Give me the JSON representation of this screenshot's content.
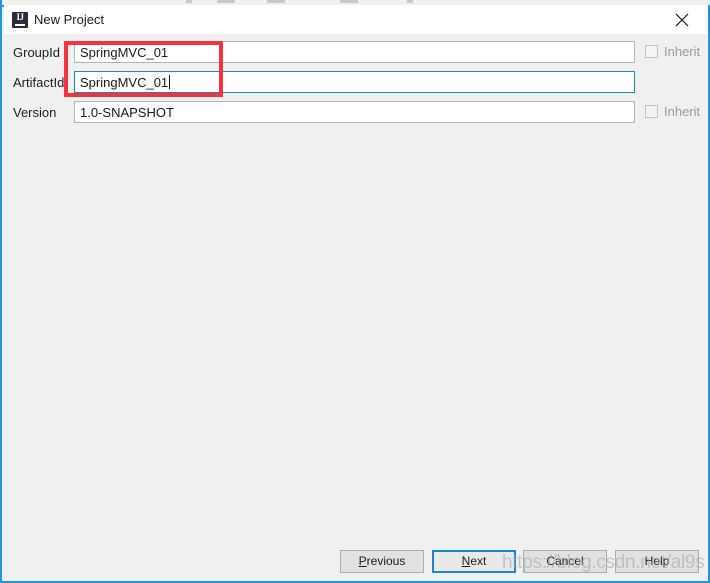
{
  "window": {
    "title": "New Project",
    "app_icon": "intellij-idea-icon",
    "icon_text": "IJ",
    "close_icon": "close-icon",
    "accent_color": "#2196d9",
    "titlebar_background": "#ffffff",
    "body_background": "#f0f0f0"
  },
  "form": {
    "rows": [
      {
        "label": "GroupId",
        "value": "SpringMVC_01",
        "focused": false,
        "inherit_label": "Inherit",
        "inherit_checked": false,
        "inherit_enabled": false
      },
      {
        "label": "ArtifactId",
        "value": "SpringMVC_01",
        "focused": true,
        "has_caret": true,
        "inherit_label": "",
        "inherit_checked": false,
        "inherit_enabled": false
      },
      {
        "label": "Version",
        "value": "1.0-SNAPSHOT",
        "focused": false,
        "inherit_label": "Inherit",
        "inherit_checked": false,
        "inherit_enabled": false
      }
    ]
  },
  "annotation": {
    "type": "rectangle-highlight",
    "color": "#f5333f"
  },
  "footer": {
    "buttons": [
      {
        "label": "Previous",
        "mnemonic": "P",
        "rest": "revious",
        "default": false
      },
      {
        "label": "Next",
        "mnemonic": "N",
        "rest": "ext",
        "default": true
      },
      {
        "label": "Cancel",
        "mnemonic": "",
        "rest": "Cancel",
        "default": false
      },
      {
        "label": "Help",
        "mnemonic": "",
        "rest": "Help",
        "default": false
      }
    ]
  },
  "watermark": {
    "text": "https://blog.csdn.net/al9s"
  }
}
